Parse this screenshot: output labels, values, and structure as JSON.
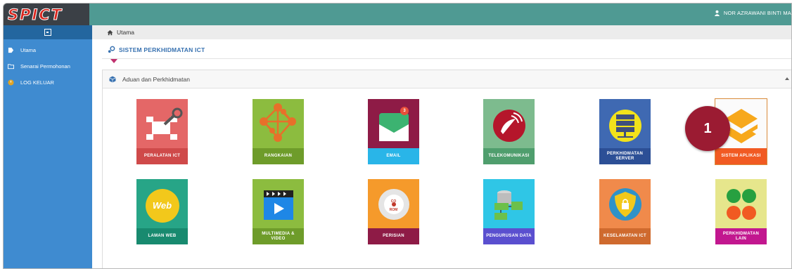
{
  "app": {
    "logo_text": "SPICT"
  },
  "header": {
    "user_name": "NOR AZRAWANI BINTI MA"
  },
  "sidebar": {
    "items": [
      {
        "label": "Utama",
        "icon": "tag-icon"
      },
      {
        "label": "Senarai Permohonan",
        "icon": "folder-icon"
      },
      {
        "label": "LOG KELUAR",
        "icon": "power-icon"
      }
    ]
  },
  "breadcrumb": {
    "label": "Utama"
  },
  "page": {
    "title": "SISTEM PERKHIDMATAN ICT"
  },
  "panel": {
    "title": "Aduan dan Perkhidmatan"
  },
  "tiles": [
    {
      "label": "PERALATAN ICT",
      "top_color": "#e46767",
      "bottom_color": "#cf4a4a"
    },
    {
      "label": "RANGKAIAN",
      "top_color": "#8cbc3f",
      "bottom_color": "#6e9c2a"
    },
    {
      "label": "EMAIL",
      "top_color": "#8e1b46",
      "bottom_color": "#29b5e8",
      "badge": "3"
    },
    {
      "label": "TELEKOMUNIKASI",
      "top_color": "#7dbb8e",
      "bottom_color": "#4f9e6d"
    },
    {
      "label": "PERKHIDMATAN SERVER",
      "top_color": "#3f69b2",
      "bottom_color": "#2c4f96"
    },
    {
      "label": "SISTEM APLIKASI",
      "top_color": "#fbfbfb",
      "bottom_color": "#f15a22"
    },
    {
      "label": "LAMAN WEB",
      "top_color": "#27a587",
      "bottom_color": "#188a6f"
    },
    {
      "label": "MULTIMEDIA & VIDEO",
      "top_color": "#8cbc3f",
      "bottom_color": "#6e9c2a"
    },
    {
      "label": "PERISIAN",
      "top_color": "#f59a2b",
      "bottom_color": "#8e1b46"
    },
    {
      "label": "PENGURUSAN DATA",
      "top_color": "#2fc6e6",
      "bottom_color": "#5a4fcf"
    },
    {
      "label": "KESELAMATAN ICT",
      "top_color": "#f08a4b",
      "bottom_color": "#cf6a2e"
    },
    {
      "label": "PERKHIDMATAN LAIN",
      "top_color": "#e6e68c",
      "bottom_color": "#c2178f"
    }
  ],
  "annotation": {
    "step": "1"
  }
}
